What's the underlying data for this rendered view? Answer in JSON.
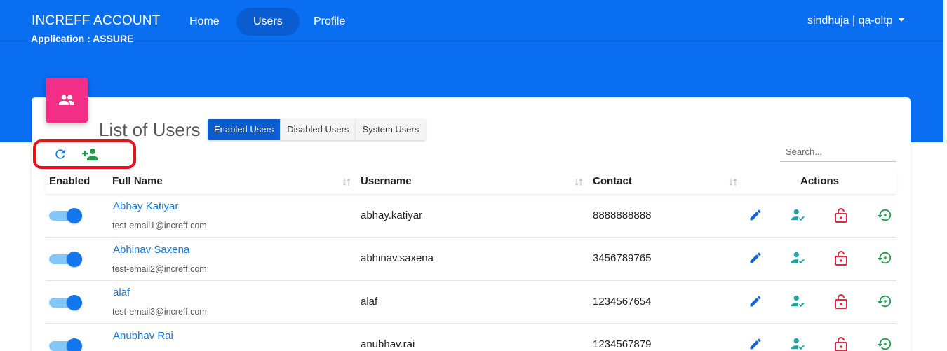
{
  "app": {
    "title": "INCREFF ACCOUNT",
    "subtitle": "Application : ASSURE"
  },
  "nav": {
    "items": [
      {
        "label": "Home",
        "active": false
      },
      {
        "label": "Users",
        "active": true
      },
      {
        "label": "Profile",
        "active": false
      }
    ],
    "user_menu": "sindhuja | qa-oltp"
  },
  "page": {
    "title": "List of Users",
    "tabs": [
      {
        "label": "Enabled Users",
        "active": true
      },
      {
        "label": "Disabled Users",
        "active": false
      },
      {
        "label": "System Users",
        "active": false
      }
    ]
  },
  "toolbar": {
    "buttons": [
      {
        "icon": "refresh-icon"
      },
      {
        "icon": "add-user-icon"
      }
    ]
  },
  "search": {
    "placeholder": "Search...",
    "value": ""
  },
  "table": {
    "headers": [
      "Enabled",
      "Full Name",
      "Username",
      "Contact",
      "Actions"
    ],
    "rows": [
      {
        "enabled": true,
        "full_name": "Abhay Katiyar",
        "email": "test-email1@increff.com",
        "username": "abhay.katiyar",
        "contact": "8888888888"
      },
      {
        "enabled": true,
        "full_name": "Abhinav Saxena",
        "email": "test-email2@increff.com",
        "username": "abhinav.saxena",
        "contact": "3456789765"
      },
      {
        "enabled": true,
        "full_name": "alaf",
        "email": "test-email3@increff.com",
        "username": "alaf",
        "contact": "1234567654"
      },
      {
        "enabled": true,
        "full_name": "Anubhav Rai",
        "email": "",
        "username": "anubhav.rai",
        "contact": "1234567879"
      }
    ],
    "actions": [
      "edit-icon",
      "user-check-icon",
      "lock-open-icon",
      "reset-icon"
    ]
  },
  "colors": {
    "header_bg": "#0a6ef0",
    "active_nav": "#0a5cd1",
    "card_icon_bg": "#f22e86",
    "link": "#1877d6",
    "toggle_knob": "#1276ec",
    "toggle_track": "#82c7f7",
    "edit": "#1565d8",
    "user_check": "#20a3a3",
    "lock": "#e0293f",
    "reset": "#1e9b4a",
    "highlight_outline": "#e8101b"
  }
}
